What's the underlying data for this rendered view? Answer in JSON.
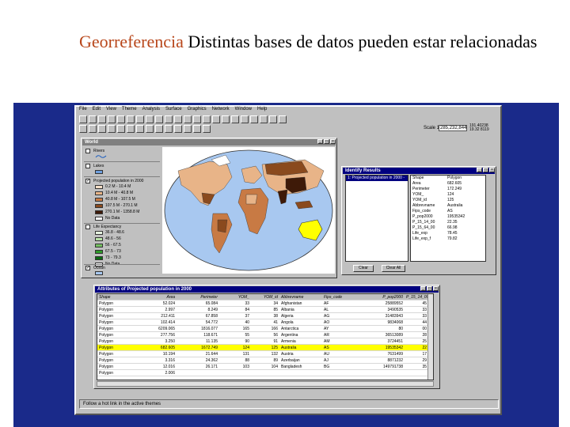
{
  "slide": {
    "title_keyword": "Georreferencia",
    "title_rest": " Distintas bases de datos pueden estar relacionadas"
  },
  "menu": [
    "File",
    "Edit",
    "View",
    "Theme",
    "Analysis",
    "Surface",
    "Graphics",
    "Network",
    "Window",
    "Help"
  ],
  "scale": {
    "label": "Scale 1:",
    "value": "285,232,844",
    "coords": [
      "191.40238",
      "19.32 8119"
    ]
  },
  "world_window": {
    "title": "World",
    "legend": {
      "rivers": "Rivers",
      "lakes": "Lakes",
      "projected_title": "Projected population in 2000",
      "projected_classes": [
        {
          "label": "0.2 M - 10.4 M",
          "color": "#f6e0c8"
        },
        {
          "label": "10.4 M - 40.8 M",
          "color": "#e8b488"
        },
        {
          "label": "40.8 M - 107.5 M",
          "color": "#c87a44"
        },
        {
          "label": "107.5 M - 270.1 M",
          "color": "#8a4a1e"
        },
        {
          "label": "270.1 M - 1358.8 M",
          "color": "#3e1a08"
        },
        {
          "label": "No Data",
          "color": "#ffffff"
        }
      ],
      "life_title": "Life Expectancy",
      "life_classes": [
        {
          "label": "36.8 - 48.6",
          "color": "#e6f3e0"
        },
        {
          "label": "48.6 - 56",
          "color": "#b8e0a8"
        },
        {
          "label": "56 - 67.5",
          "color": "#74c060"
        },
        {
          "label": "67.5 - 73",
          "color": "#2e9a2a"
        },
        {
          "label": "73 - 79.3",
          "color": "#0a6a12"
        },
        {
          "label": "No Data",
          "color": "#ffffff"
        }
      ],
      "ocean": "Ocean"
    }
  },
  "identify": {
    "title": "Identify Results",
    "selected": "1: Projected population in 2000 -",
    "fields": [
      [
        "Shape",
        "Polygon"
      ],
      [
        "Area",
        "682.605"
      ],
      [
        "Perimeter",
        "172.249"
      ],
      [
        "YOM_",
        "124"
      ],
      [
        "YOM_id",
        "125"
      ],
      [
        "Abbrevname",
        "Australia"
      ],
      [
        "Fips_code",
        "AS"
      ],
      [
        "P_pop2000",
        "19535342"
      ],
      [
        "P_15_14_00",
        "22.35"
      ],
      [
        "P_15_64_00",
        "66.98"
      ],
      [
        "Life_exp",
        "78.45"
      ],
      [
        "Life_exp_f",
        "79.82"
      ]
    ],
    "clear": "Clear",
    "clear_all": "Clear All"
  },
  "attributes": {
    "title": "Attributes of Projected population in 2000",
    "headers": [
      "Shape",
      "Area",
      "Perimeter",
      "YOM_",
      "YOM_id",
      "Abbrevname",
      "Fips_code",
      "P_pop2000",
      "P_15_14_00"
    ],
    "rows": [
      [
        "Polygon",
        "52.024",
        "65.084",
        "33",
        "34",
        "Afghanistan",
        "AF",
        "25889552",
        "45"
      ],
      [
        "Polygon",
        "2.997",
        "8.249",
        "84",
        "85",
        "Albania",
        "AL",
        "3490535",
        "33"
      ],
      [
        "Polygon",
        "212.411",
        "67.858",
        "37",
        "38",
        "Algeria",
        "AG",
        "31483943",
        "33"
      ],
      [
        "Polygon",
        "102.414",
        "54.772",
        "40",
        "41",
        "Angola",
        "AO",
        "9834068",
        "44"
      ],
      [
        "Polygon",
        "6209.065",
        "1816.077",
        "165",
        "166",
        "Antarctica",
        "AY",
        "80",
        "00"
      ],
      [
        "Polygon",
        "277.756",
        "118.671",
        "55",
        "56",
        "Argentina",
        "AR",
        "36513089",
        "28"
      ],
      [
        "Polygon",
        "3.250",
        "11.135",
        "90",
        "91",
        "Armenia",
        "AM",
        "3724451",
        "25"
      ],
      [
        "Polygon",
        "682.605",
        "1672.749",
        "124",
        "125",
        "Australia",
        "AS",
        "19535342",
        "22"
      ],
      [
        "Polygon",
        "10.194",
        "21.644",
        "131",
        "132",
        "Austria",
        "AU",
        "7631499",
        "17"
      ],
      [
        "Polygon",
        "3.316",
        "24.362",
        "88",
        "89",
        "Azerbaijan",
        "AJ",
        "8871232",
        "29"
      ],
      [
        "Polygon",
        "12.016",
        "26.171",
        "103",
        "104",
        "Bangladesh",
        "BG",
        "149791738",
        "35"
      ],
      [
        "Polygon",
        "2.006",
        "",
        "",
        "",
        "",
        "",
        "",
        ""
      ]
    ],
    "highlight_row": 7
  },
  "status": "Follow a hot link in the active themes"
}
